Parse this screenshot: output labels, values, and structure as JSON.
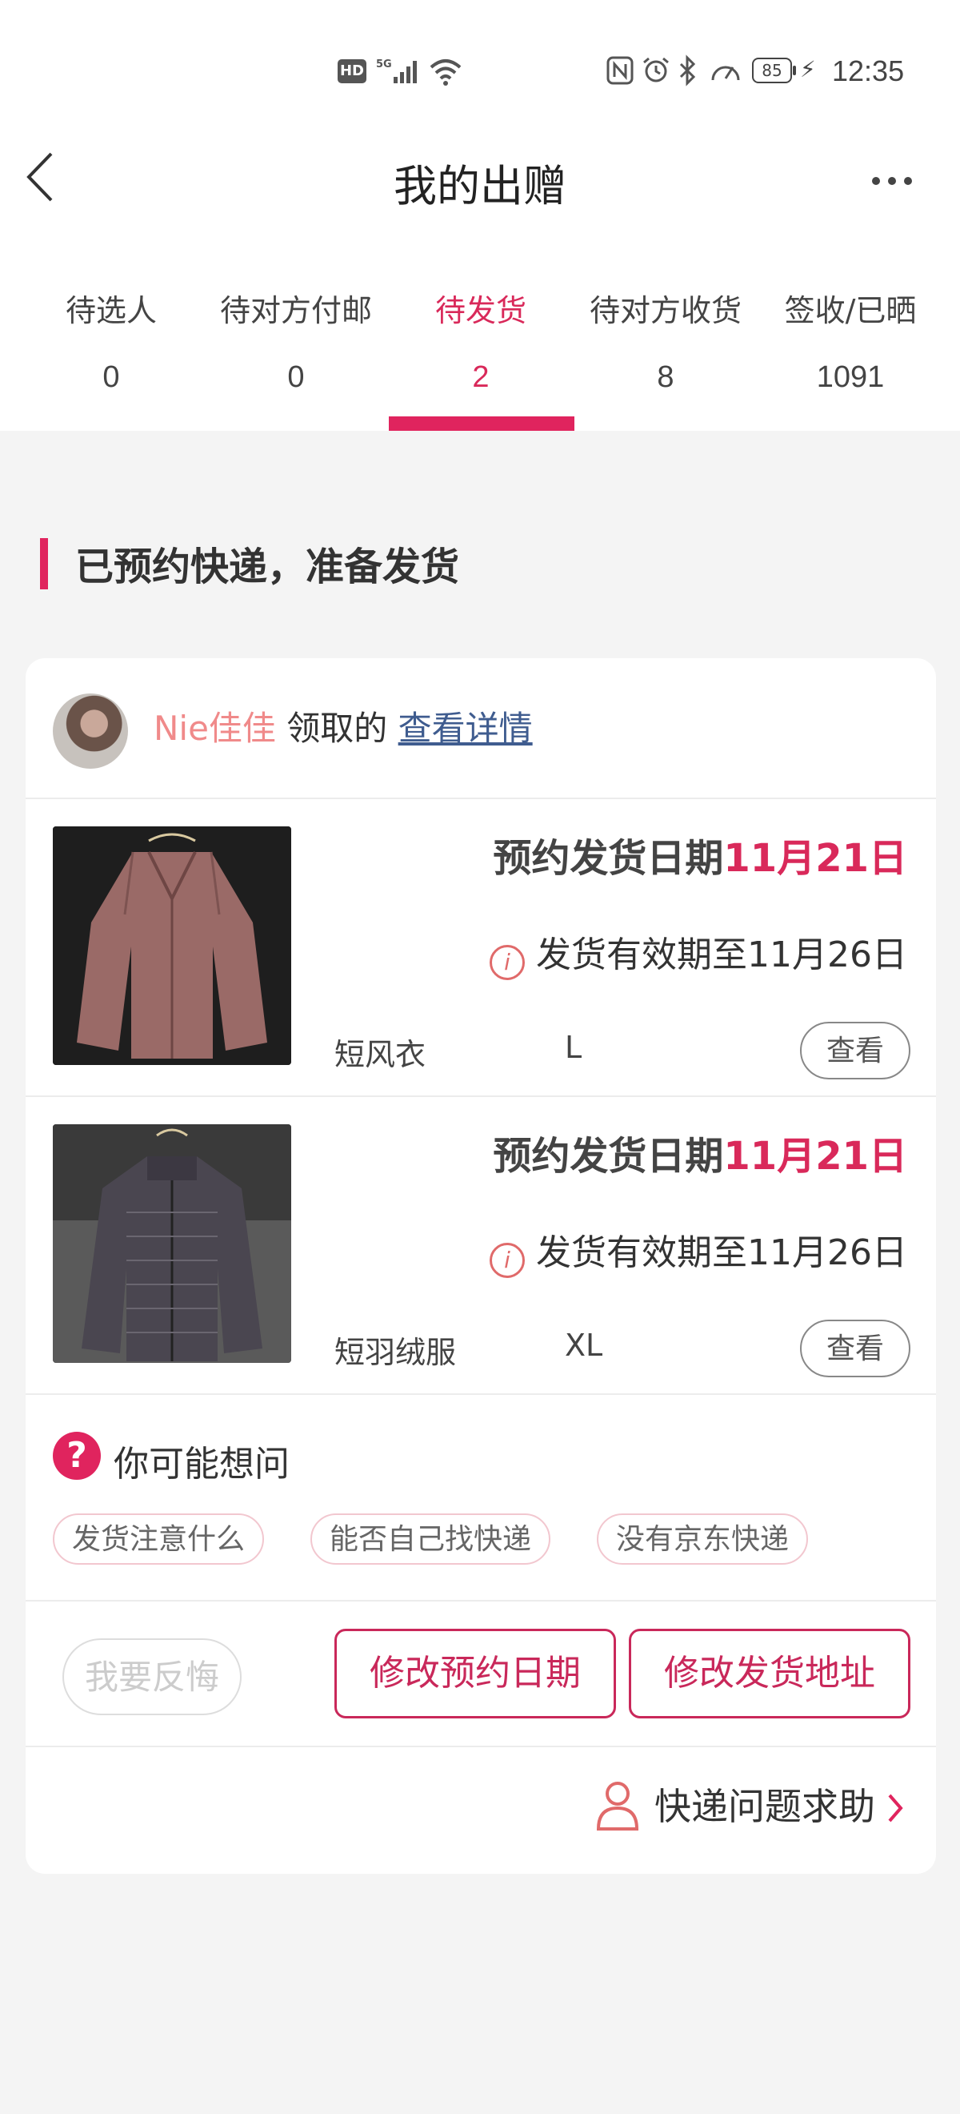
{
  "status_bar": {
    "hd": "HD",
    "network": "5G",
    "battery": "85",
    "time": "12:35"
  },
  "header": {
    "title": "我的出赠"
  },
  "tabs": [
    {
      "label": "待选人",
      "count": "0"
    },
    {
      "label": "待对方付邮",
      "count": "0"
    },
    {
      "label": "待发货",
      "count": "2"
    },
    {
      "label": "待对方收货",
      "count": "8"
    },
    {
      "label": "签收/已晒",
      "count": "1091"
    }
  ],
  "active_tab": 2,
  "section": {
    "title": "已预约快递，准备发货"
  },
  "receiver": {
    "nickname": "Nie佳佳",
    "action": " 领取的 ",
    "link": "查看详情"
  },
  "items": [
    {
      "ship_label": "预约发货日期",
      "ship_date": "11月21日",
      "valid_text": "发货有效期至11月26日",
      "name": "短风衣",
      "size": "L",
      "view_label": "查看"
    },
    {
      "ship_label": "预约发货日期",
      "ship_date": "11月21日",
      "valid_text": "发货有效期至11月26日",
      "name": "短羽绒服",
      "size": "XL",
      "view_label": "查看"
    }
  ],
  "faq": {
    "icon": "?",
    "title": "你可能想问",
    "chips": [
      "发货注意什么",
      "能否自己找快递",
      "没有京东快递"
    ]
  },
  "actions": {
    "regret": "我要反悔",
    "change_date": "修改预约日期",
    "change_address": "修改发货地址"
  },
  "help": {
    "label": "快递问题求助"
  },
  "colors": {
    "accent": "#e0245e",
    "link": "#3f5c8f",
    "nickname": "#f08a8a"
  }
}
